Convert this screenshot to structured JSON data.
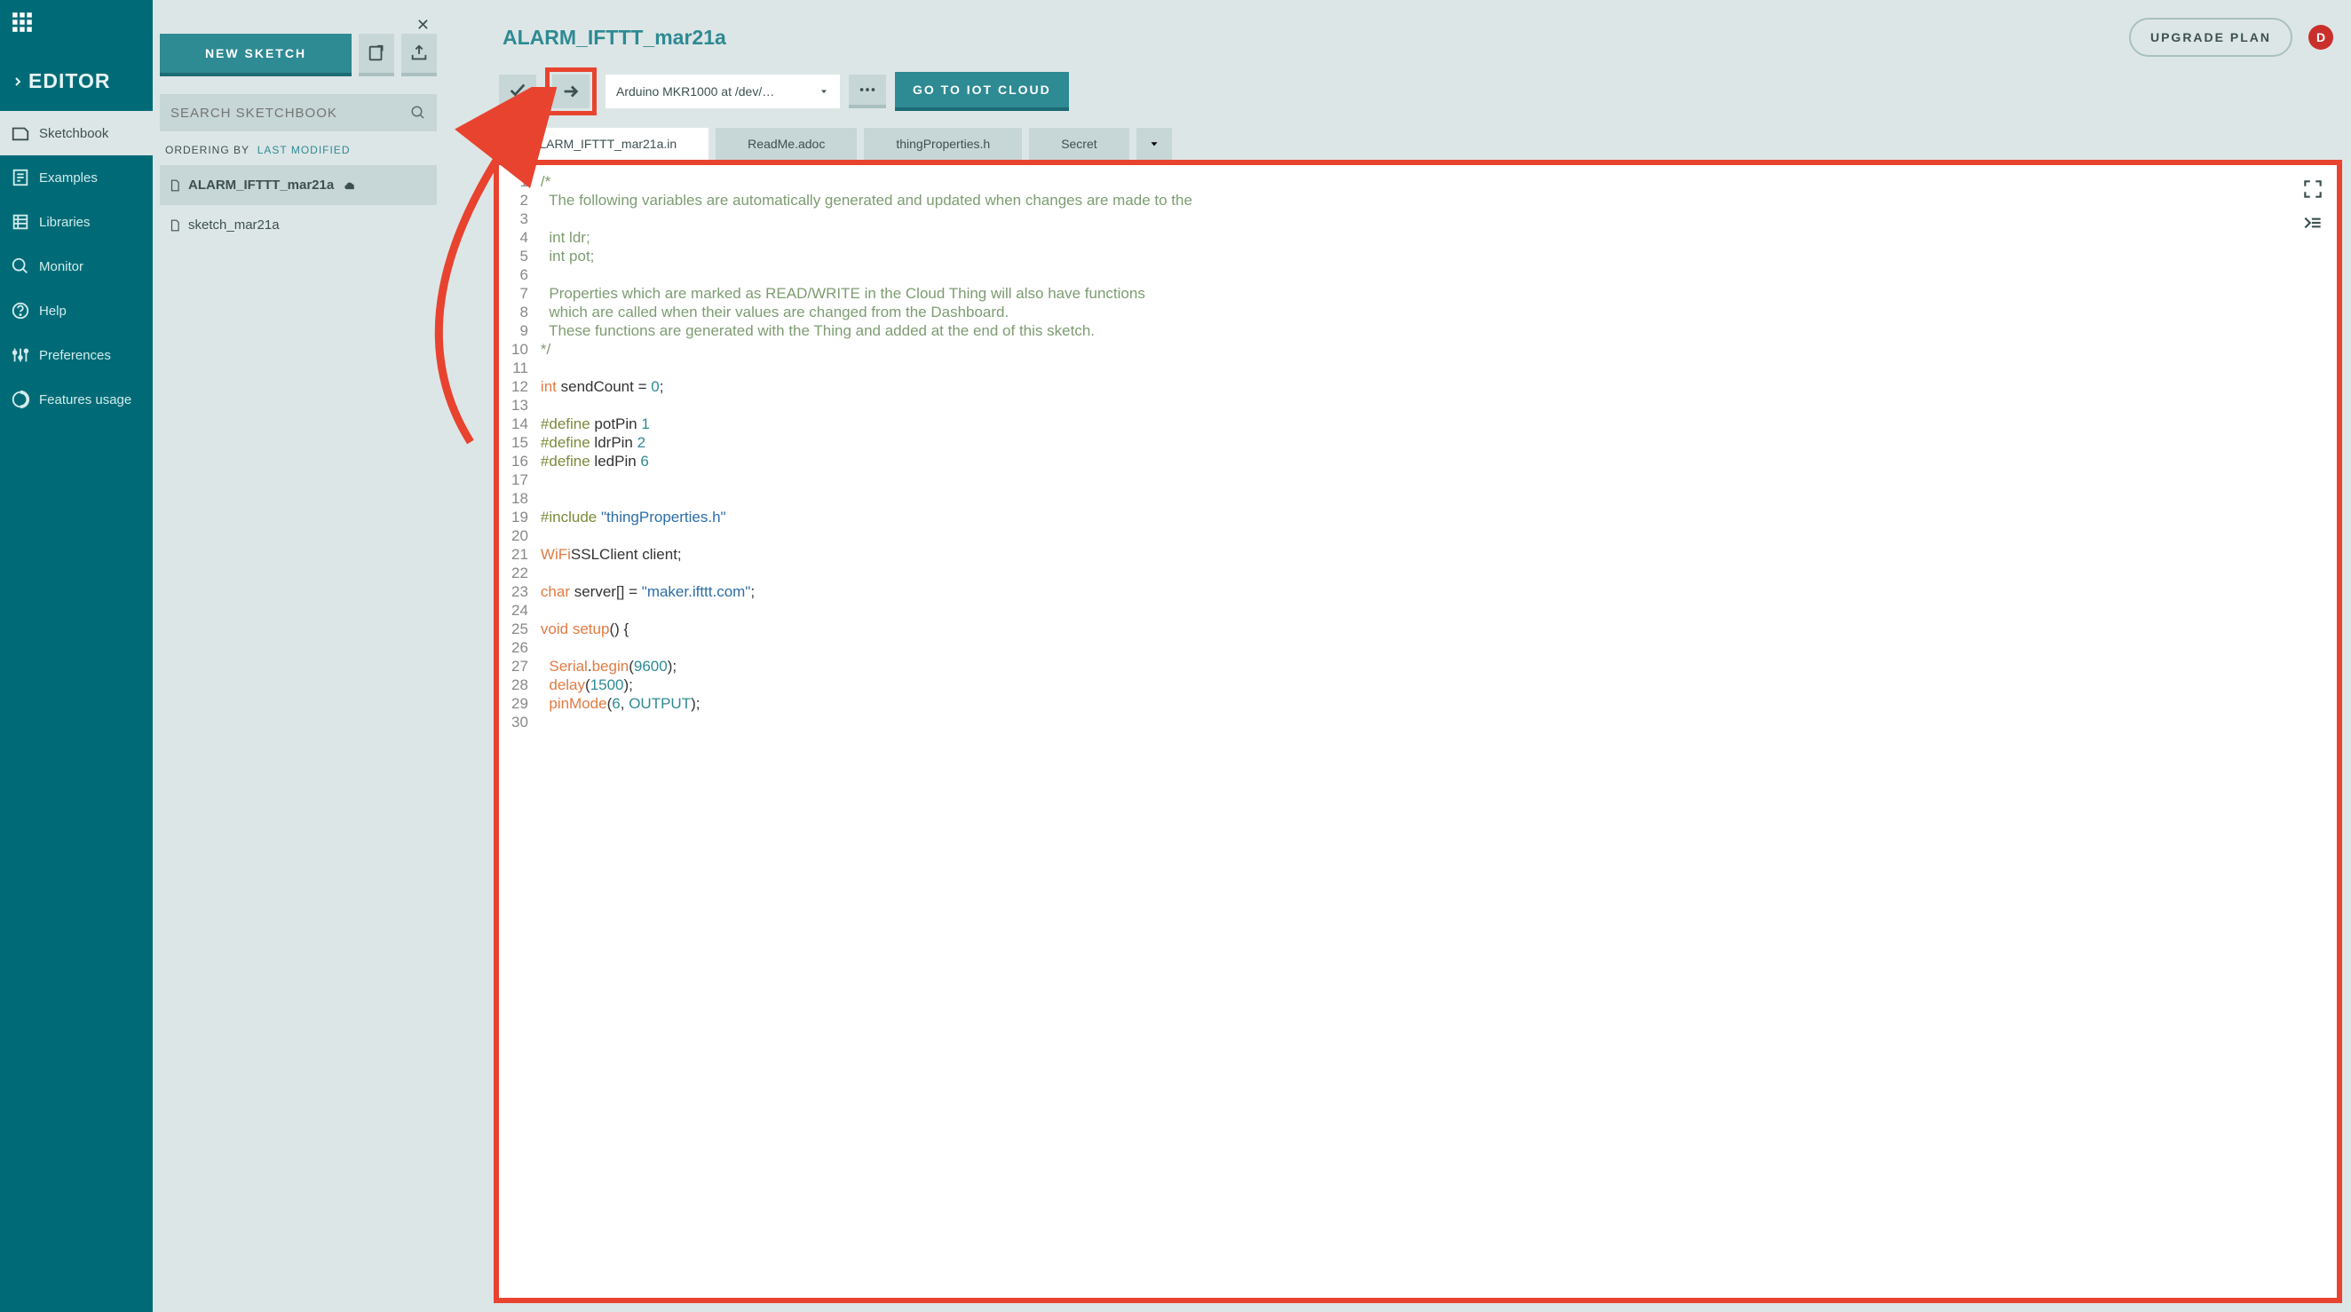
{
  "sidebar": {
    "title": "EDITOR",
    "items": [
      {
        "label": "Sketchbook",
        "active": true
      },
      {
        "label": "Examples"
      },
      {
        "label": "Libraries"
      },
      {
        "label": "Monitor"
      },
      {
        "label": "Help"
      },
      {
        "label": "Preferences"
      },
      {
        "label": "Features usage"
      }
    ]
  },
  "col2": {
    "new_sketch": "NEW SKETCH",
    "search_placeholder": "SEARCH SKETCHBOOK",
    "ordering_by": "ORDERING BY",
    "ordering_value": "LAST MODIFIED",
    "sketches": [
      {
        "name": "ALARM_IFTTT_mar21a",
        "active": true,
        "cloud": true
      },
      {
        "name": "sketch_mar21a"
      }
    ]
  },
  "header": {
    "project_title": "ALARM_IFTTT_mar21a",
    "upgrade": "UPGRADE PLAN",
    "avatar": "D"
  },
  "toolbar": {
    "board": "Arduino MKR1000 at /dev/…",
    "iot_cloud": "GO TO IOT CLOUD"
  },
  "tabs": [
    {
      "label": "ALARM_IFTTT_mar21a.in",
      "active": true
    },
    {
      "label": "ReadMe.adoc"
    },
    {
      "label": "thingProperties.h"
    },
    {
      "label": "Secret"
    }
  ],
  "code": {
    "lines": [
      {
        "n": 1,
        "t": "/*",
        "cls": "c-comment"
      },
      {
        "n": 2,
        "t": "  The following variables are automatically generated and updated when changes are made to the",
        "cls": "c-comment"
      },
      {
        "n": 3,
        "t": "",
        "cls": ""
      },
      {
        "n": 4,
        "t": "  int ldr;",
        "cls": "c-comment"
      },
      {
        "n": 5,
        "t": "  int pot;",
        "cls": "c-comment"
      },
      {
        "n": 6,
        "t": "",
        "cls": ""
      },
      {
        "n": 7,
        "t": "  Properties which are marked as READ/WRITE in the Cloud Thing will also have functions",
        "cls": "c-comment"
      },
      {
        "n": 8,
        "t": "  which are called when their values are changed from the Dashboard.",
        "cls": "c-comment"
      },
      {
        "n": 9,
        "t": "  These functions are generated with the Thing and added at the end of this sketch.",
        "cls": "c-comment"
      },
      {
        "n": 10,
        "t": "*/",
        "cls": "c-comment"
      },
      {
        "n": 11,
        "t": "",
        "cls": ""
      },
      {
        "n": 12,
        "html": "<span class='c-type'>int</span> sendCount = <span class='c-literal'>0</span>;"
      },
      {
        "n": 13,
        "t": "",
        "cls": ""
      },
      {
        "n": 14,
        "html": "<span class='c-define'>#define</span> potPin <span class='c-literal'>1</span>"
      },
      {
        "n": 15,
        "html": "<span class='c-define'>#define</span> ldrPin <span class='c-literal'>2</span>"
      },
      {
        "n": 16,
        "html": "<span class='c-define'>#define</span> ledPin <span class='c-literal'>6</span>"
      },
      {
        "n": 17,
        "t": "",
        "cls": ""
      },
      {
        "n": 18,
        "t": "",
        "cls": ""
      },
      {
        "n": 19,
        "html": "<span class='c-define'>#include</span> <span class='c-str'>\"thingProperties.h\"</span>"
      },
      {
        "n": 20,
        "t": "",
        "cls": ""
      },
      {
        "n": 21,
        "html": "<span class='c-builtin'>WiFi</span>SSLClient client;"
      },
      {
        "n": 22,
        "t": "",
        "cls": ""
      },
      {
        "n": 23,
        "html": "<span class='c-type'>char</span> server[] = <span class='c-str'>\"maker.ifttt.com\"</span>;"
      },
      {
        "n": 24,
        "t": "",
        "cls": ""
      },
      {
        "n": 25,
        "html": "<span class='c-type'>void</span> <span class='c-builtin'>setup</span>() {"
      },
      {
        "n": 26,
        "t": "",
        "cls": ""
      },
      {
        "n": 27,
        "html": "  <span class='c-builtin'>Serial</span>.<span class='c-builtin'>begin</span>(<span class='c-literal'>9600</span>);"
      },
      {
        "n": 28,
        "html": "  <span class='c-builtin'>delay</span>(<span class='c-literal'>1500</span>);"
      },
      {
        "n": 29,
        "html": "  <span class='c-builtin'>pinMode</span>(<span class='c-literal'>6</span>, <span class='c-literal'>OUTPUT</span>);"
      },
      {
        "n": 30,
        "t": "",
        "cls": ""
      }
    ]
  }
}
